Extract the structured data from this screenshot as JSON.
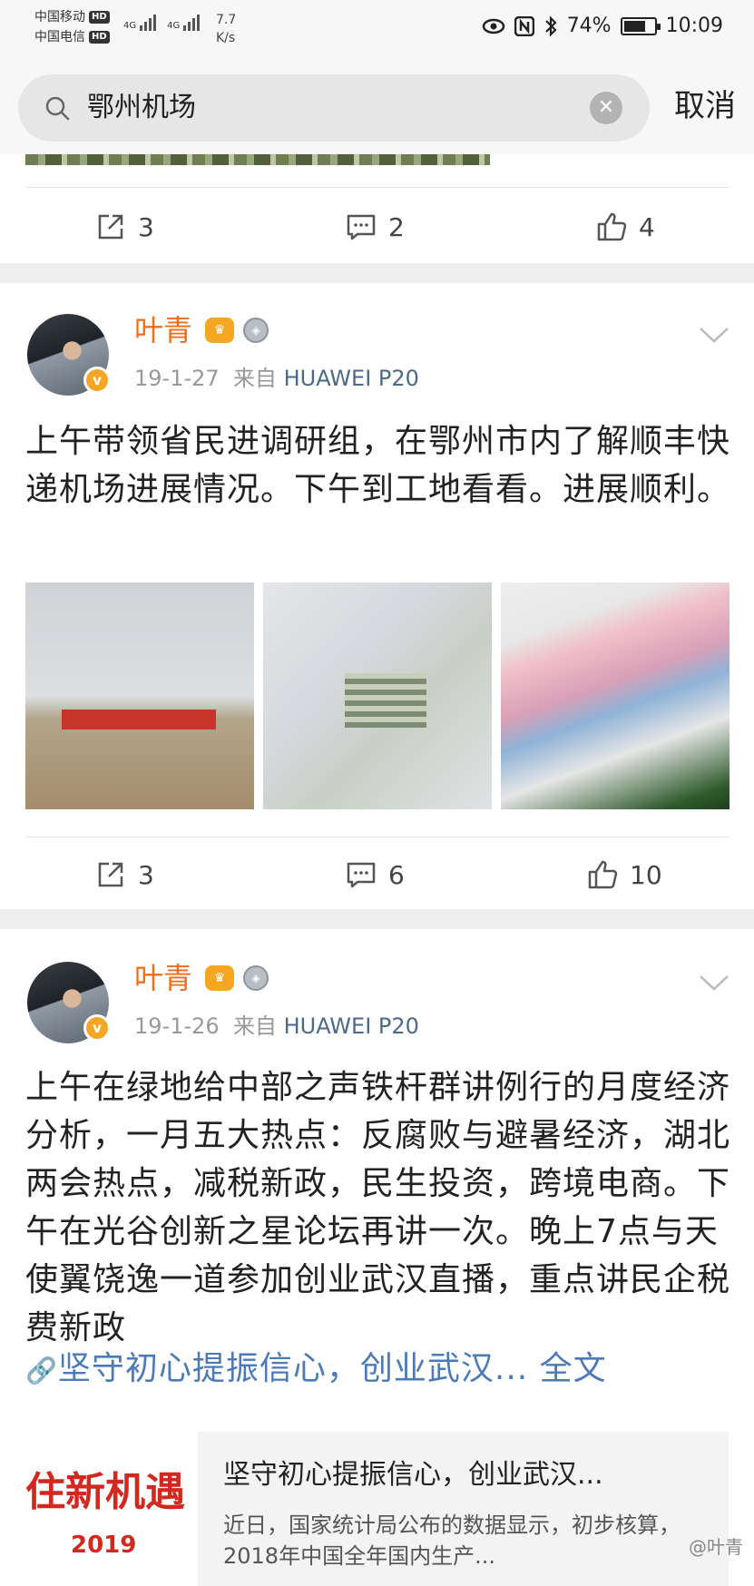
{
  "status_bar": {
    "carrier_1": "中国移动",
    "carrier_2": "中国电信",
    "hd_label": "HD",
    "network_1": "4G",
    "network_2": "4G",
    "speed_value": "7.7",
    "speed_unit": "K/s",
    "battery": "74%",
    "battery_level": 0.74,
    "time": "10:09"
  },
  "search": {
    "query": "鄂州机场",
    "cancel_label": "取消"
  },
  "top_actions": {
    "repost_count": "3",
    "comment_count": "2",
    "like_count": "4"
  },
  "posts": [
    {
      "author": "叶青",
      "date": "19-1-27",
      "source_prefix": "来自",
      "device": "HUAWEI P20",
      "text": "上午带领省民进调研组，在鄂州市内了解顺丰快递机场进展情况。下午到工地看看。进展顺利。",
      "repost_count": "3",
      "comment_count": "6",
      "like_count": "10"
    },
    {
      "author": "叶青",
      "date": "19-1-26",
      "source_prefix": "来自",
      "device": "HUAWEI P20",
      "text": "上午在绿地给中部之声铁杆群讲例行的月度经济分析，一月五大热点：反腐败与避暑经济，湖北两会热点，减税新政，民生投资，跨境电商。下午在光谷创新之星论坛再讲一次。晚上7点与天使翼饶逸一道参加创业武汉直播，重点讲民企税费新政",
      "link_text": "坚守初心提振信心，创业武汉...",
      "full_text_label": "全文",
      "card": {
        "image_text": "住新机遇",
        "image_year": "2019",
        "title": "坚守初心提振信心，创业武汉...",
        "desc": "近日，国家统计局公布的数据显示，初步核算，2018年中国全年国内生产..."
      }
    }
  ],
  "watermark": "@叶青"
}
